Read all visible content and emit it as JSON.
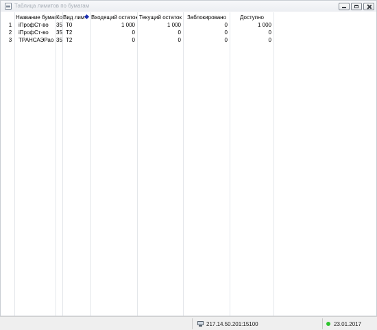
{
  "window": {
    "title": "Таблица лимитов по бумагам",
    "buttons": {
      "minimize": "minimize-icon",
      "maximize": "maximize-icon",
      "close": "close-icon"
    }
  },
  "table": {
    "columns": [
      "Название бумаги",
      "Ко",
      "Вид лим",
      "Входящий остаток",
      "Текущий остаток",
      "Заблокировано",
      "Доступно"
    ],
    "rows": [
      {
        "num": "1",
        "name": "iПрофСт-во",
        "code": "35",
        "type": "T0",
        "incoming": "1 000",
        "current": "1 000",
        "blocked": "0",
        "available": "1 000"
      },
      {
        "num": "2",
        "name": "iПрофСт-во",
        "code": "35",
        "type": "T2",
        "incoming": "0",
        "current": "0",
        "blocked": "0",
        "available": "0"
      },
      {
        "num": "3",
        "name": "ТРАНСАЭРао",
        "code": "35",
        "type": "T2",
        "incoming": "0",
        "current": "0",
        "blocked": "0",
        "available": "0"
      }
    ]
  },
  "statusbar": {
    "connection": "217.14.50.201:15100",
    "date": "23.01.2017",
    "status_color": "#2ec42e"
  }
}
